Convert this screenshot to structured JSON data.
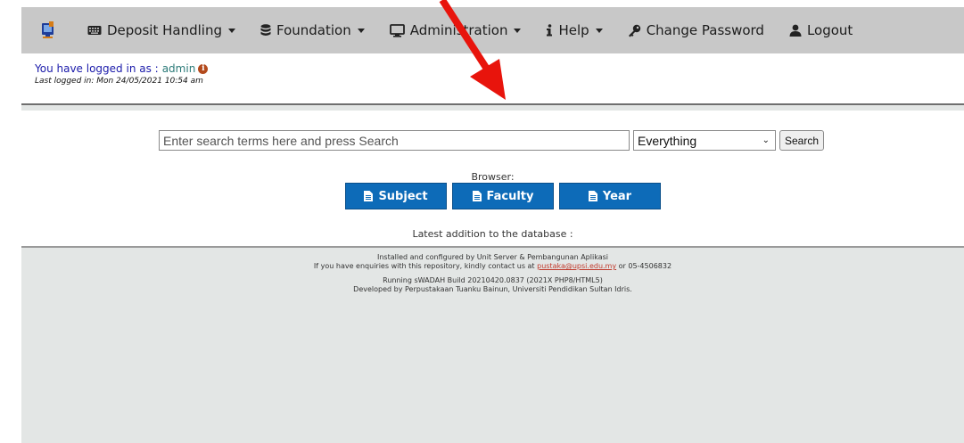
{
  "nav": {
    "deposit": "Deposit Handling",
    "foundation": "Foundation",
    "administration": "Administration",
    "help": "Help",
    "change_password": "Change Password",
    "logout": "Logout"
  },
  "user": {
    "logged_label": "You have logged in as :",
    "username": "admin",
    "last_login": "Last logged in: Mon 24/05/2021 10:54 am"
  },
  "search": {
    "placeholder": "Enter search terms here and press Search",
    "scope": "Everything",
    "button": "Search"
  },
  "browser": {
    "label": "Browser:",
    "buttons": [
      "Subject",
      "Faculty",
      "Year"
    ]
  },
  "latest": "Latest addition to the database :",
  "footer": {
    "line1": "Installed and configured by Unit Server & Pembangunan Aplikasi",
    "line2_pre": "If you have enquiries with this repository, kindly contact us at ",
    "email": "pustaka@upsi.edu.my",
    "line2_post": " or 05-4506832",
    "line3": "Running sWADAH Build 20210420.0837 (2021X PHP8/HTML5)",
    "line4": "Developed by Perpustakaan Tuanku Bainun, Universiti Pendidikan Sultan Idris."
  },
  "colors": {
    "navbar": "#c8c8c8",
    "browse_button": "#0d6bb8",
    "arrow": "#e8140c",
    "background": "#e3e6e5"
  }
}
